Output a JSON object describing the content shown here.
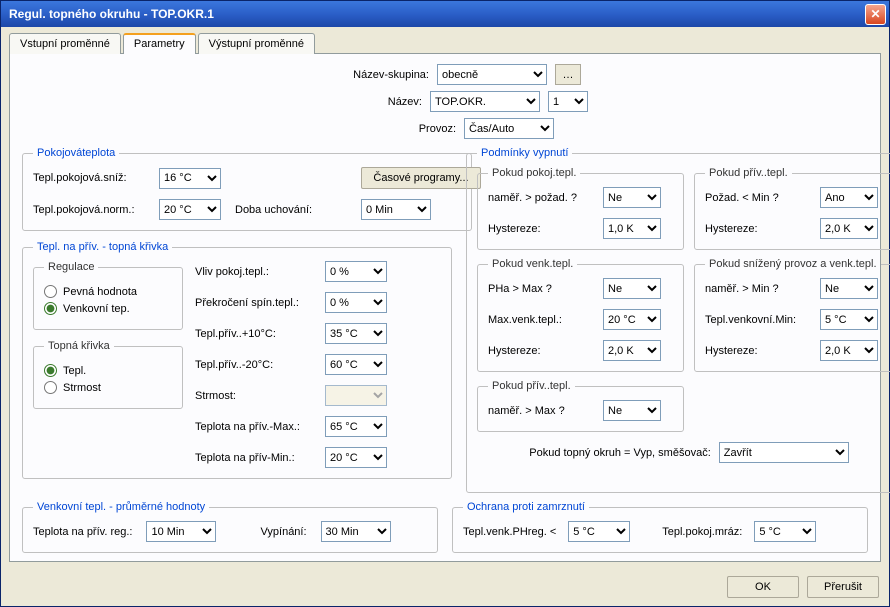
{
  "title": "Regul. topného okruhu - TOP.OKR.1",
  "tabs": {
    "inputs": "Vstupní proměnné",
    "params": "Parametry",
    "outputs": "Výstupní proměnné"
  },
  "top": {
    "groupLabel": "Název-skupina:",
    "groupValue": "obecně",
    "nameLabel": "Název:",
    "nameValue": "TOP.OKR.",
    "nameIndex": "1",
    "modeLabel": "Provoz:",
    "modeValue": "Čas/Auto"
  },
  "roomTemp": {
    "legend": "Pokojováteplota",
    "lowLabel": "Tepl.pokojová.sníž:",
    "lowValue": "16 °C",
    "normLabel": "Tepl.pokojová.norm.:",
    "normValue": "20 °C",
    "btnTimePrograms": "Časové programy...",
    "retentionLabel": "Doba uchování:",
    "retentionValue": "0 Min"
  },
  "heatingCurve": {
    "legend": "Tepl. na přív. - topná křivka",
    "regLegend": "Regulace",
    "regFixed": "Pevná hodnota",
    "regOutdoor": "Venkovní tep.",
    "curveLegend": "Topná křivka",
    "curveTemp": "Tepl.",
    "curveSlope": "Strmost",
    "roomInfLabel": "Vliv pokoj.tepl.:",
    "roomInfValue": "0 %",
    "switchOverLabel": "Překročení spín.tepl.:",
    "switchOverValue": "0 %",
    "flowP10Label": "Tepl.přív..+10°C:",
    "flowP10Value": "35 °C",
    "flowM20Label": "Tepl.přív..-20°C:",
    "flowM20Value": "60 °C",
    "slopeLabel": "Strmost:",
    "slopeValue": "",
    "flowMaxLabel": "Teplota na přív.-Max.:",
    "flowMaxValue": "65 °C",
    "flowMinLabel": "Teplota na přív-Min.:",
    "flowMinValue": "20 °C"
  },
  "outdoorAvg": {
    "legend": "Venkovní tepl. - průměrné hodnoty",
    "regLabel": "Teplota na přív. reg.:",
    "regValue": "10 Min",
    "offLabel": "Vypínání:",
    "offValue": "30 Min"
  },
  "shutdown": {
    "legend": "Podmínky vypnutí",
    "roomLegend": "Pokud pokoj.tepl.",
    "roomMeasLabel": "naměř. > požad. ?",
    "roomMeasValue": "Ne",
    "roomHystLabel": "Hystereze:",
    "roomHystValue": "1,0 K",
    "flowLegend": "Pokud přív..tepl.",
    "flowReqLabel": "Požad. < Min ?",
    "flowReqValue": "Ano",
    "flowHystLabel": "Hystereze:",
    "flowHystValue": "2,0 K",
    "outLegend": "Pokud venk.tepl.",
    "outPHaLabel": "PHa > Max ?",
    "outPHaValue": "Ne",
    "outMaxLabel": "Max.venk.tepl.:",
    "outMaxValue": "20 °C",
    "outHystLabel": "Hystereze:",
    "outHystValue": "2,0 K",
    "reducedLegend": "Pokud snížený provoz a venk.tepl.",
    "reducedMeasLabel": "naměř. > Min ?",
    "reducedMeasValue": "Ne",
    "reducedMinLabel": "Tepl.venkovní.Min:",
    "reducedMinValue": "5 °C",
    "reducedHystLabel": "Hystereze:",
    "reducedHystValue": "2,0 K",
    "flow2Legend": "Pokud přív..tepl.",
    "flow2MeasLabel": "naměř. > Max ?",
    "flow2MeasValue": "Ne",
    "mixerLabel": "Pokud topný okruh = Vyp, směšovač:",
    "mixerValue": "Zavřít"
  },
  "frost": {
    "legend": "Ochrana proti zamrznutí",
    "outLabel": "Tepl.venk.PHreg. <",
    "outValue": "5 °C",
    "roomLabel": "Tepl.pokoj.mráz:",
    "roomValue": "5 °C"
  },
  "footer": {
    "ok": "OK",
    "cancel": "Přerušit"
  }
}
